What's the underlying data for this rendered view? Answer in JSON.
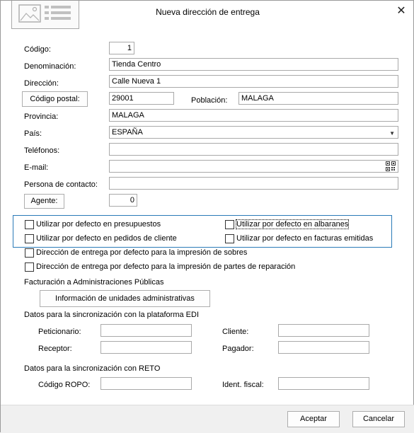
{
  "dialog": {
    "title": "Nueva dirección de entrega",
    "close_glyph": "✕"
  },
  "form": {
    "codigo": {
      "label": "Código:",
      "value": "1"
    },
    "denominacion": {
      "label": "Denominación:",
      "value": "Tienda Centro"
    },
    "direccion": {
      "label": "Dirección:",
      "value": "Calle Nueva 1"
    },
    "codigo_postal": {
      "button_label": "Código postal:",
      "value": "29001"
    },
    "poblacion": {
      "label": "Población:",
      "value": "MALAGA"
    },
    "provincia": {
      "label": "Provincia:",
      "value": "MALAGA"
    },
    "pais": {
      "label": "País:",
      "value": "ESPAÑA"
    },
    "telefonos": {
      "label": "Teléfonos:",
      "value": ""
    },
    "email": {
      "label": "E-mail:",
      "value": ""
    },
    "persona_contacto": {
      "label": "Persona de contacto:",
      "value": ""
    },
    "agente": {
      "button_label": "Agente:",
      "value": "0"
    }
  },
  "checkboxes": {
    "presupuestos": {
      "label": "Utilizar por defecto en presupuestos",
      "checked": false
    },
    "albaranes": {
      "label": "Utilizar por defecto en albaranes",
      "checked": false
    },
    "pedidos": {
      "label": "Utilizar por defecto en pedidos de cliente",
      "checked": false
    },
    "facturas": {
      "label": "Utilizar por defecto en facturas emitidas",
      "checked": false
    },
    "sobres": {
      "label": "Dirección de entrega por defecto para la impresión de sobres",
      "checked": false
    },
    "reparacion": {
      "label": "Dirección de entrega por defecto para la impresión de partes de reparación",
      "checked": false
    }
  },
  "administraciones": {
    "heading": "Facturación a Administraciones Públicas",
    "button_label": "Información de unidades administrativas"
  },
  "edi": {
    "heading": "Datos para la sincronización con la plataforma EDI",
    "peticionario": {
      "label": "Peticionario:",
      "value": ""
    },
    "cliente": {
      "label": "Cliente:",
      "value": ""
    },
    "receptor": {
      "label": "Receptor:",
      "value": ""
    },
    "pagador": {
      "label": "Pagador:",
      "value": ""
    }
  },
  "reto": {
    "heading": "Datos para la sincronización con RETO",
    "codigo_ropo": {
      "label": "Código ROPO:",
      "value": ""
    },
    "ident_fiscal": {
      "label": "Ident. fiscal:",
      "value": ""
    }
  },
  "footer": {
    "accept_label": "Aceptar",
    "cancel_label": "Cancelar"
  },
  "icons": {
    "dropdown": "▼",
    "qr": "qr-code-icon",
    "header_logo": "address-card-icon"
  },
  "colors": {
    "group_border": "#2a7ab8",
    "window_bg": "#ffffff",
    "footer_bg": "#f0f0f0"
  }
}
